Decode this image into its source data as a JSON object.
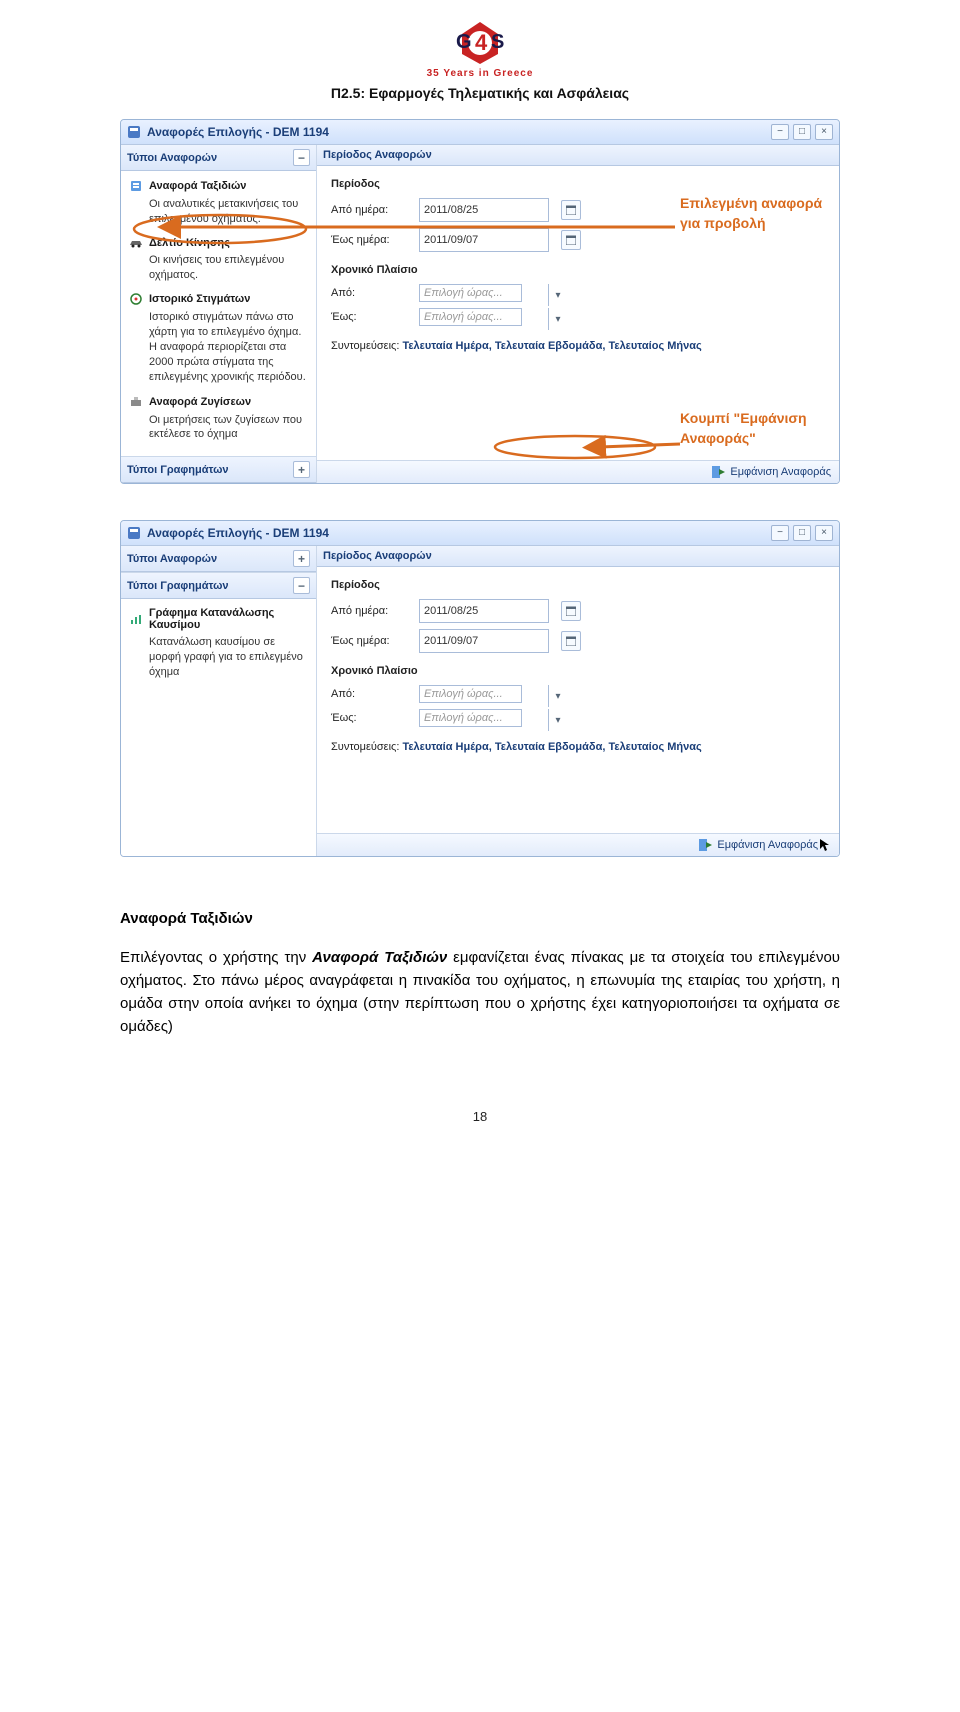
{
  "logo_sub": "35 Years in Greece",
  "doc_title": "Π2.5: Εφαρμογές Τηλεματικής και Ασφάλειας",
  "window_title": "Αναφορές Επιλογής - DEM 1194",
  "sidebar": {
    "types_header": "Τύποι Αναφορών",
    "charts_header": "Τύποι Γραφημάτων",
    "types": [
      {
        "title": "Αναφορά Ταξιδιών",
        "desc": "Οι αναλυτικές μετακινήσεις του επιλεγμένου οχήματος."
      },
      {
        "title": "Δελτίο Κίνησης",
        "desc": "Οι κινήσεις του επιλεγμένου οχήματος."
      },
      {
        "title": "Ιστορικό Στιγμάτων",
        "desc": "Ιστορικό στιγμάτων πάνω στο χάρτη για το επιλεγμένο όχημα. Η αναφορά περιορίζεται στα 2000 πρώτα στίγματα της επιλεγμένης χρονικής περιόδου."
      },
      {
        "title": "Αναφορά Ζυγίσεων",
        "desc": "Οι μετρήσεις των ζυγίσεων που εκτέλεσε το όχημα"
      }
    ],
    "chart_item": {
      "title": "Γράφημα Κατανάλωσης Καυσίμου",
      "desc": "Κατανάλωση καυσίμου σε μορφή γραφή για το επιλεγμένο όχημα"
    }
  },
  "period_panel": {
    "header": "Περίοδος Αναφορών",
    "section1": "Περίοδος",
    "from_date_label": "Από ημέρα:",
    "from_date_value": "2011/08/25",
    "to_date_label": "Έως ημέρα:",
    "to_date_value": "2011/09/07",
    "section2": "Χρονικό Πλαίσιο",
    "from_time_label": "Από:",
    "to_time_label": "Έως:",
    "time_placeholder": "Επιλογή ώρας...",
    "shortcuts_label": "Συντομεύσεις: ",
    "shortcuts_links": "Τελευταία Ημέρα, Τελευταία Εβδομάδα, Τελευταίος Μήνας"
  },
  "footer_btn": "Εμφάνιση Αναφοράς",
  "footer_btn_cursor": "Εμφάνιση Αναφοράς",
  "annotations": {
    "selected": "Επιλεγμένη αναφορά για προβολή",
    "button": "Κουμπί \"Εμφάνιση Αναφοράς\""
  },
  "body": {
    "heading": "Αναφορά Ταξιδιών",
    "para_pre": "Επιλέγοντας ο χρήστης την ",
    "para_bold": "Αναφορά Ταξιδιών",
    "para_post": " εμφανίζεται ένας πίνακας με τα στοιχεία του επιλεγμένου οχήματος. Στο πάνω μέρος αναγράφεται η πινακίδα του οχήματος, η επωνυμία της εταιρίας του χρήστη, η ομάδα στην οποία ανήκει το όχημα (στην περίπτωση που ο χρήστης έχει κατηγοριοποιήσει τα οχήματα σε ομάδες)"
  },
  "page_number": "18"
}
